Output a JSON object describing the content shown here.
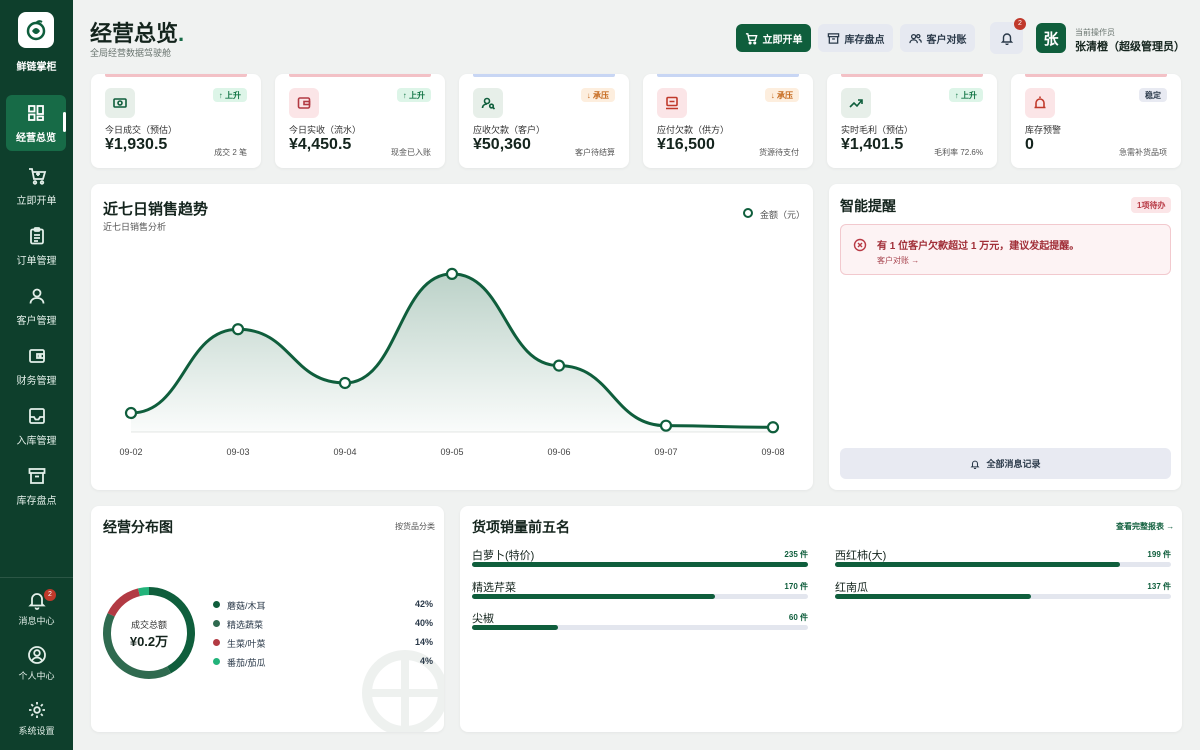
{
  "sidebar": {
    "brand": "鲜链掌柜",
    "nav": [
      {
        "label": "经营总览",
        "icon": "dashboard-icon"
      },
      {
        "label": "立即开单",
        "icon": "cart-icon"
      },
      {
        "label": "订单管理",
        "icon": "clipboard-icon"
      },
      {
        "label": "客户管理",
        "icon": "user-icon"
      },
      {
        "label": "财务管理",
        "icon": "wallet-icon"
      },
      {
        "label": "入库管理",
        "icon": "inbox-icon"
      },
      {
        "label": "库存盘点",
        "icon": "archive-icon"
      }
    ],
    "bottom": [
      {
        "label": "消息中心",
        "icon": "bell-icon",
        "badge": "2"
      },
      {
        "label": "个人中心",
        "icon": "profile-icon"
      },
      {
        "label": "系统设置",
        "icon": "gear-icon"
      }
    ]
  },
  "header": {
    "title": "经营总览",
    "subtitle": "全局经营数据驾驶舱",
    "buttons": {
      "create_order": "立即开单",
      "inventory": "库存盘点",
      "reconcile": "客户对账"
    },
    "notif_count": "2",
    "user": {
      "avatar": "张",
      "role": "当前操作员",
      "name": "张清橙（超级管理员）"
    }
  },
  "kpis": [
    {
      "label": "今日成交（预估）",
      "value": "¥1,930.5",
      "note": "成交 2 笔",
      "badge": "↑ 上升",
      "icon": "cash-icon",
      "tone": "up"
    },
    {
      "label": "今日实收（流水）",
      "value": "¥4,450.5",
      "note": "现金已入账",
      "badge": "↑ 上升",
      "icon": "wallet-icon",
      "tone": "up"
    },
    {
      "label": "应收欠款（客户）",
      "value": "¥50,360",
      "note": "客户待结算",
      "badge": "↓ 承压",
      "icon": "user-search-icon",
      "tone": "down"
    },
    {
      "label": "应付欠款（供方）",
      "value": "¥16,500",
      "note": "货源待支付",
      "badge": "↓ 承压",
      "icon": "bill-icon",
      "tone": "down"
    },
    {
      "label": "实时毛利（预估）",
      "value": "¥1,401.5",
      "note": "毛利率 72.6%",
      "badge": "↑ 上升",
      "icon": "trend-up-icon",
      "tone": "up"
    },
    {
      "label": "库存预警",
      "value": "0",
      "note": "急需补货品项",
      "badge": "稳定",
      "icon": "alarm-icon",
      "tone": "stable"
    }
  ],
  "trend": {
    "title": "近七日销售趋势",
    "subtitle": "近七日销售分析",
    "legend": "金额（元）"
  },
  "chart_data": {
    "type": "area",
    "categories": [
      "09-02",
      "09-03",
      "09-04",
      "09-05",
      "09-06",
      "09-07",
      "09-08"
    ],
    "series": [
      {
        "name": "金额（元）",
        "values": [
          120,
          650,
          310,
          1000,
          420,
          40,
          30
        ]
      }
    ],
    "ylim": [
      0,
      1050
    ],
    "grid": false
  },
  "alerts": {
    "title": "智能提醒",
    "count": "1项待办",
    "items": [
      {
        "text": "有 1 位客户欠款超过 1 万元，建议发起提醒。",
        "link": "客户对账 →"
      }
    ],
    "all_button": "全部消息记录"
  },
  "distribution": {
    "title": "经营分布图",
    "filter": "按货品分类",
    "center_label": "成交总额",
    "center_value": "¥0.2万",
    "items": [
      {
        "name": "蘑菇/木耳",
        "pct": "42%",
        "value": 42,
        "color": "#0f5e3c"
      },
      {
        "name": "精选蔬菜",
        "pct": "40%",
        "value": 40,
        "color": "#2f6a4f"
      },
      {
        "name": "生菜/叶菜",
        "pct": "14%",
        "value": 14,
        "color": "#b23a43"
      },
      {
        "name": "番茄/茄瓜",
        "pct": "4%",
        "value": 4,
        "color": "#22b37a"
      }
    ]
  },
  "top5": {
    "title": "货项销量前五名",
    "link": "查看完整报表 →",
    "max": 235,
    "items": [
      {
        "name": "白萝卜(特价)",
        "count": "235 件",
        "value": 235
      },
      {
        "name": "西红柿(大)",
        "count": "199 件",
        "value": 199
      },
      {
        "name": "精选芹菜",
        "count": "170 件",
        "value": 170
      },
      {
        "name": "红南瓜",
        "count": "137 件",
        "value": 137
      },
      {
        "name": "尖椒",
        "count": "60 件",
        "value": 60
      }
    ]
  },
  "colors": {
    "brand": "#0f5e3c",
    "sidebar": "#0e3f2c",
    "danger": "#b83a45"
  }
}
